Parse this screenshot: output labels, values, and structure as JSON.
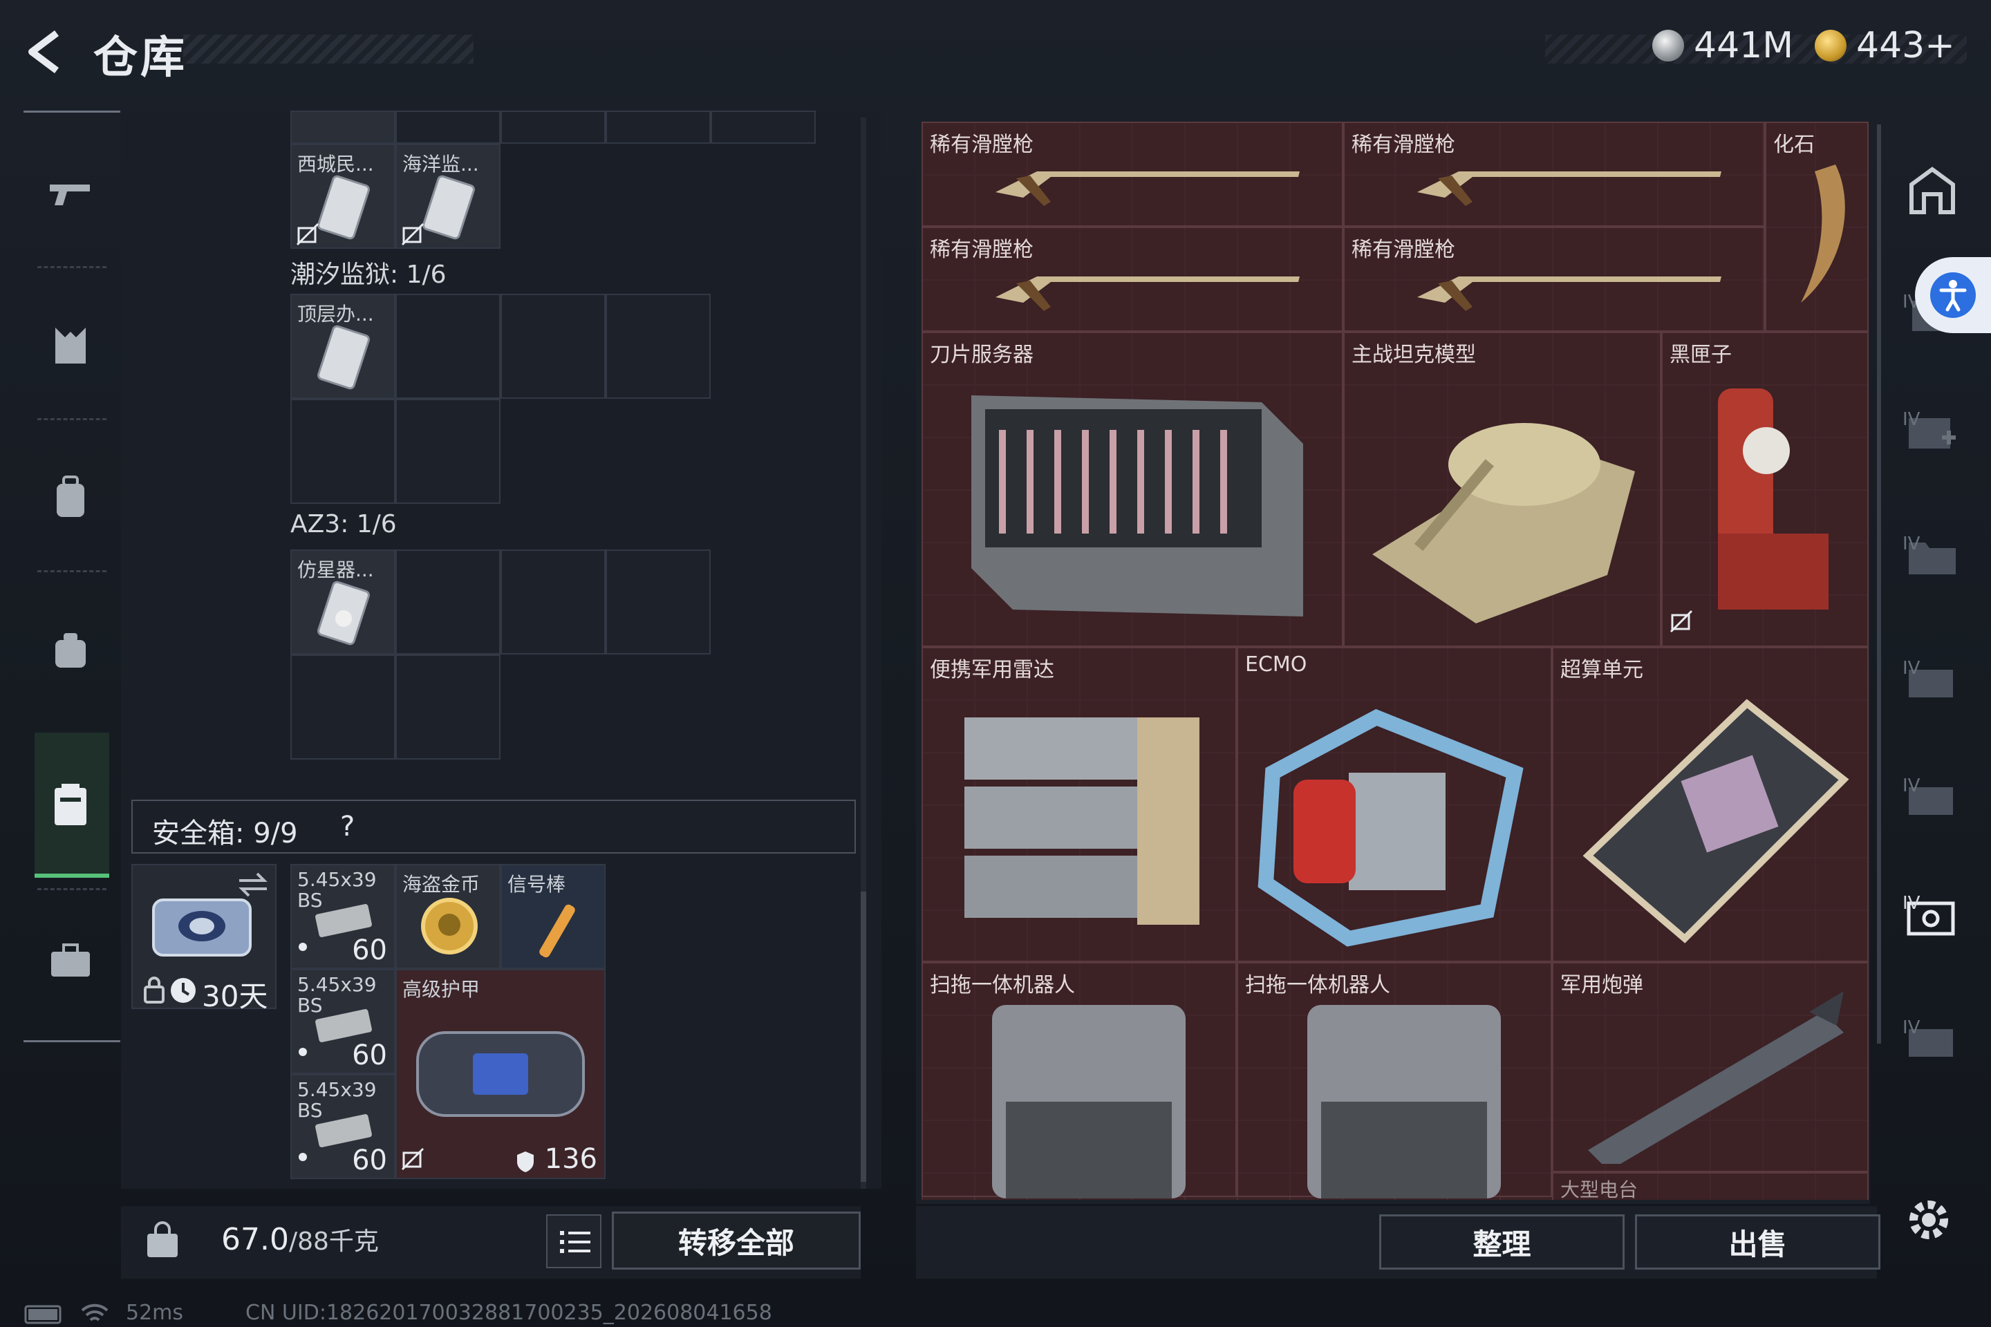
{
  "header": {
    "title": "仓库",
    "currency1": "441M",
    "currency2": "443+"
  },
  "stash": {
    "cells_top": [
      {
        "name": "西城民..."
      },
      {
        "name": "海洋监..."
      }
    ],
    "section1_label": "潮汐监狱: 1/6",
    "section1_item": "顶层办...",
    "section2_label": "AZ3: 1/6",
    "section2_item": "仿星器..."
  },
  "safebox": {
    "label": "安全箱: 9/9",
    "help": "?",
    "duration": "30天",
    "items": [
      {
        "name": "5.45x39 BS",
        "count": "60"
      },
      {
        "name": "海盗金币"
      },
      {
        "name": "信号棒"
      },
      {
        "name": "5.45x39 BS",
        "count": "60"
      },
      {
        "name": "高级护甲",
        "count": "136"
      },
      {
        "name": "5.45x39 BS",
        "count": "60"
      }
    ]
  },
  "weight": {
    "current": "67.0",
    "max": "/88千克"
  },
  "buttons": {
    "transfer_all": "转移全部",
    "organize": "整理",
    "sell": "出售"
  },
  "container": {
    "items": [
      {
        "name": "稀有滑膛枪"
      },
      {
        "name": "稀有滑膛枪"
      },
      {
        "name": "化石"
      },
      {
        "name": "稀有滑膛枪"
      },
      {
        "name": "稀有滑膛枪"
      },
      {
        "name": "刀片服务器"
      },
      {
        "name": "主战坦克模型"
      },
      {
        "name": "黑匣子"
      },
      {
        "name": "便携军用雷达"
      },
      {
        "name": "ECMO"
      },
      {
        "name": "超算单元"
      },
      {
        "name": "扫拖一体机器人"
      },
      {
        "name": "扫拖一体机器人"
      },
      {
        "name": "军用炮弹"
      },
      {
        "name": "大型电台"
      }
    ]
  },
  "rightnav": {
    "badge": "IV"
  },
  "status": {
    "ping": "52ms",
    "uid": "CN UID:18262017003288170023​5_202608041658"
  },
  "colors": {
    "accent_green": "#57c27a",
    "container_bg": "#3d2226",
    "accessibility_blue": "#2b6fe0"
  }
}
